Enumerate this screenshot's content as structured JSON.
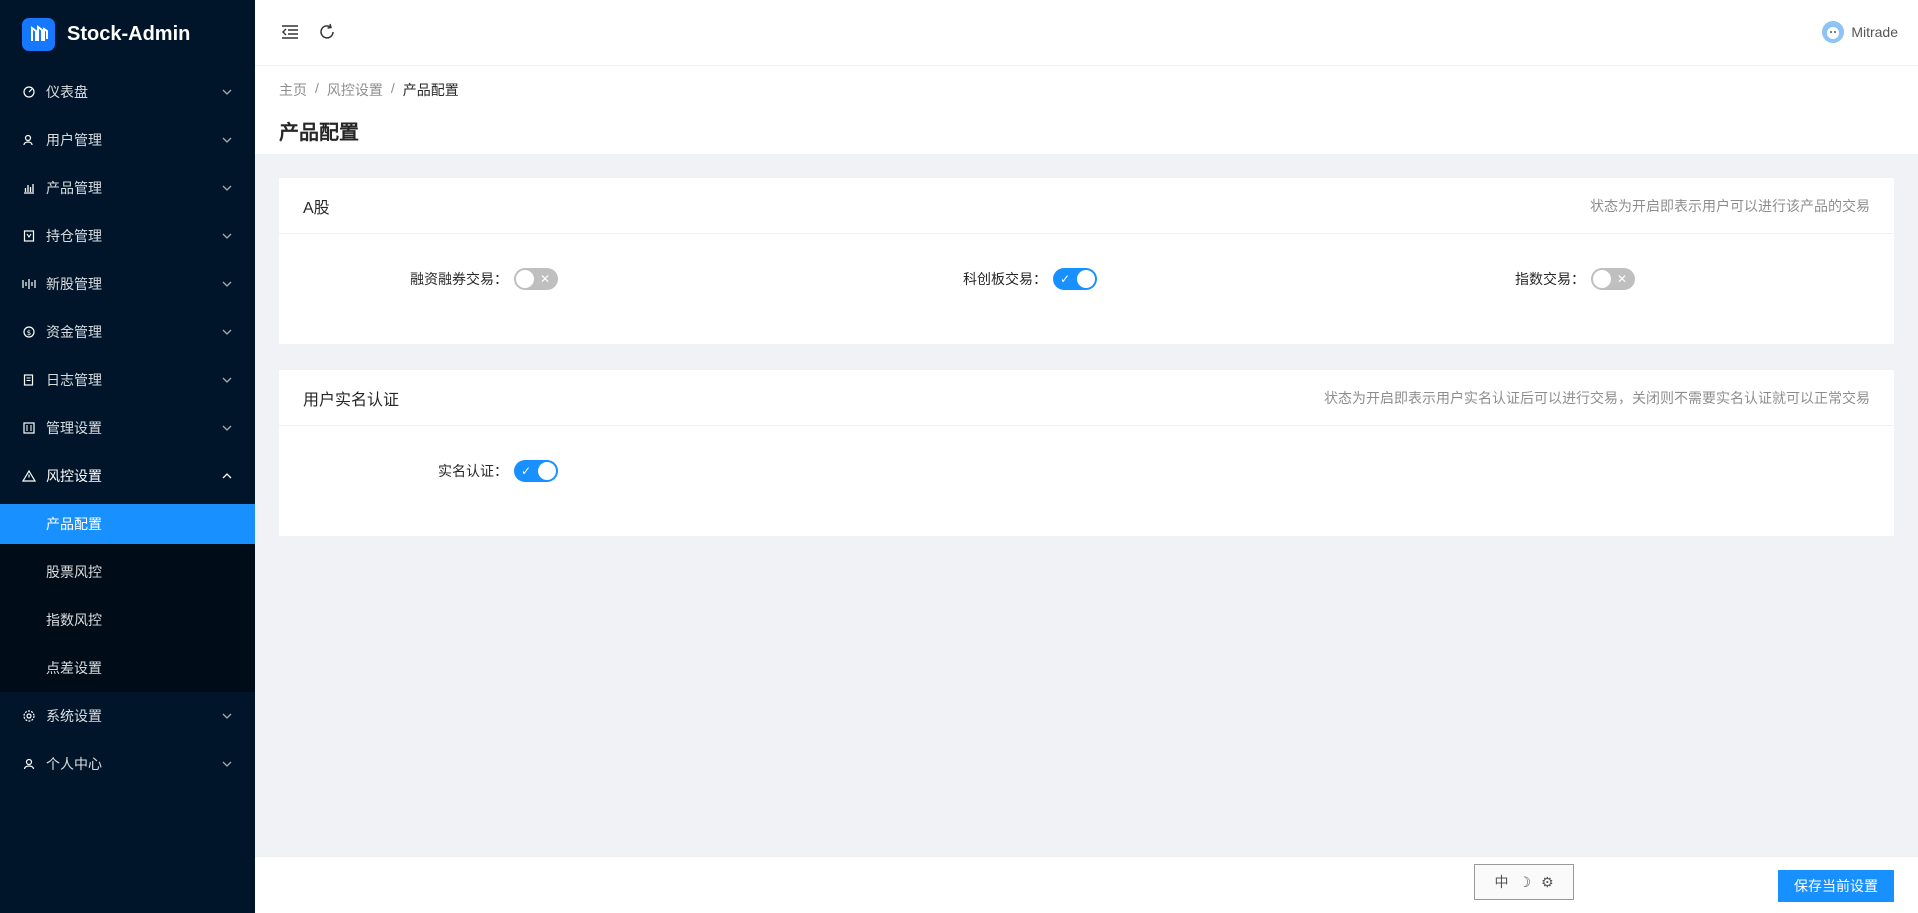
{
  "app": {
    "title": "Stock-Admin"
  },
  "sidebar": {
    "items": [
      {
        "label": "仪表盘",
        "icon": "dashboard-icon"
      },
      {
        "label": "用户管理",
        "icon": "users-icon"
      },
      {
        "label": "产品管理",
        "icon": "bar-chart-icon"
      },
      {
        "label": "持仓管理",
        "icon": "holdings-icon"
      },
      {
        "label": "新股管理",
        "icon": "signal-icon"
      },
      {
        "label": "资金管理",
        "icon": "dollar-circle-icon"
      },
      {
        "label": "日志管理",
        "icon": "log-icon"
      },
      {
        "label": "管理设置",
        "icon": "settings-panel-icon"
      },
      {
        "label": "风控设置",
        "icon": "warning-icon"
      }
    ],
    "risk_sub": [
      {
        "label": "产品配置"
      },
      {
        "label": "股票风控"
      },
      {
        "label": "指数风控"
      },
      {
        "label": "点差设置"
      }
    ],
    "bottom_items": [
      {
        "label": "系统设置",
        "icon": "gear-icon"
      },
      {
        "label": "个人中心",
        "icon": "user-icon"
      }
    ]
  },
  "header": {
    "user": "Mitrade"
  },
  "breadcrumb": {
    "home": "主页",
    "parent": "风控设置",
    "current": "产品配置"
  },
  "page": {
    "title": "产品配置"
  },
  "card_a": {
    "title": "A股",
    "extra": "状态为开启即表示用户可以进行该产品的交易",
    "fields": [
      {
        "label": "融资融券交易：",
        "on": false
      },
      {
        "label": "科创板交易：",
        "on": true
      },
      {
        "label": "指数交易：",
        "on": false
      }
    ]
  },
  "card_auth": {
    "title": "用户实名认证",
    "extra": "状态为开启即表示用户实名认证后可以进行交易，关闭则不需要实名认证就可以正常交易",
    "fields": [
      {
        "label": "实名认证：",
        "on": true
      }
    ]
  },
  "footer": {
    "save_label": "保存当前设置"
  },
  "ime": {
    "c1": "中",
    "c2": "☽",
    "c3": "⚙"
  },
  "colors": {
    "primary": "#1890ff",
    "sidebar": "#001529",
    "submenu": "#000c17"
  }
}
